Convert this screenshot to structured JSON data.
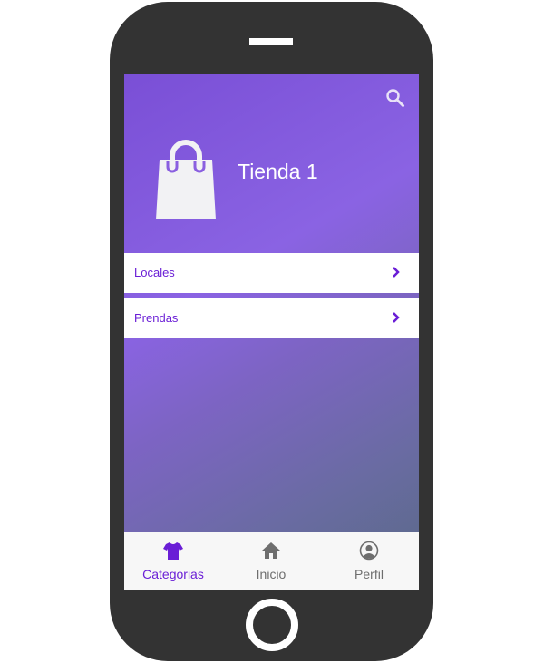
{
  "header": {
    "store_name": "Tienda 1",
    "search_icon": "search-icon",
    "bag_icon": "shopping-bag-icon"
  },
  "menu": {
    "items": [
      {
        "label": "Locales",
        "icon": "chevron-right-icon"
      },
      {
        "label": "Prendas",
        "icon": "chevron-right-icon"
      }
    ]
  },
  "tabbar": {
    "tabs": [
      {
        "label": "Categorias",
        "icon": "shirt-icon",
        "active": true
      },
      {
        "label": "Inicio",
        "icon": "home-icon",
        "active": false
      },
      {
        "label": "Perfil",
        "icon": "user-icon",
        "active": false
      }
    ]
  },
  "colors": {
    "accent": "#6a1ed6",
    "phone_body": "#333333",
    "gradient_start": "#7a4fd6",
    "gradient_end": "#596a86",
    "inactive_tab": "#6e6e6e"
  }
}
